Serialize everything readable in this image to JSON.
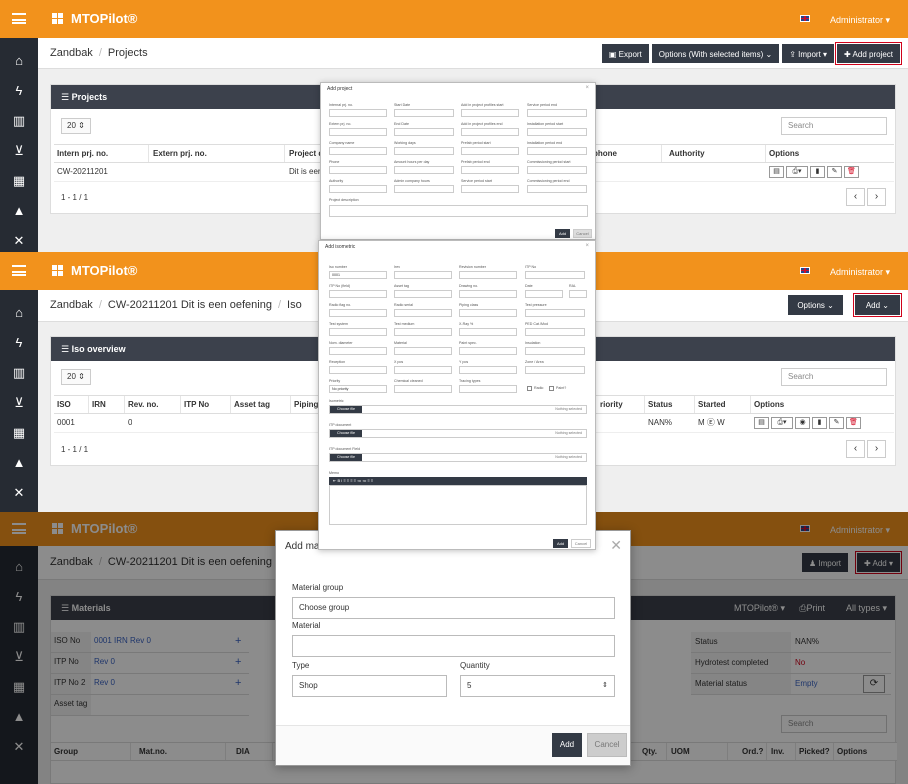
{
  "app": {
    "brand": "MTOPilot®",
    "user": "Administrator"
  },
  "nav_icons": [
    "home-icon",
    "bolt-icon",
    "books-icon",
    "cart-icon",
    "barcode-icon",
    "road-icon",
    "tools-icon"
  ],
  "panel1": {
    "crumbs": [
      "Zandbak",
      "Projects"
    ],
    "buttons": {
      "export": "Export",
      "options": "Options (With selected items) ⌄",
      "import": "Import ▾",
      "add": "✚ Add project"
    },
    "card_title": "Projects",
    "page_size": "20",
    "search_placeholder": "Search",
    "columns": [
      "Intern prj. no.",
      "Extern prj. no.",
      "Project d",
      "",
      "phone",
      "Authority",
      "Options"
    ],
    "row": [
      "CW-20211201",
      "",
      "Dit is een"
    ],
    "pager_info": "1 - 1 / 1",
    "modal": {
      "title": "Add project",
      "labels": [
        "Internal prj. no.",
        "Start Date",
        "Add in project profiles start",
        "Service period end",
        "Extern prj. no.",
        "End Date",
        "Add in project profiles end",
        "Installation period start",
        "Company name",
        "Working days",
        "Prefab period start",
        "Installation period end",
        "Phone",
        "Amount hours per day",
        "Prefab period end",
        "Commissioning period start",
        "Authority",
        "Admin company hours",
        "Service period start",
        "Commissioning period end"
      ],
      "description": "Project description",
      "add": "Add",
      "cancel": "Cancel"
    }
  },
  "panel2": {
    "crumbs": [
      "Zandbak",
      "CW-20211201 Dit is een oefening",
      "Iso"
    ],
    "buttons": {
      "options": "Options ⌄",
      "add": "Add ⌄"
    },
    "card_title": "Iso overview",
    "page_size": "20",
    "search_placeholder": "Search",
    "columns": [
      "ISO",
      "IRN",
      "Rev. no.",
      "ITP No",
      "Asset tag",
      "Piping",
      "riority",
      "Status",
      "Started",
      "Options"
    ],
    "row": {
      "iso": "0001",
      "rev": "0",
      "status": "NAN%",
      "started": "M Ⓔ W"
    },
    "pager_info": "1 - 1 / 1",
    "modal": {
      "title": "Add isometric",
      "labels": [
        "Iso number",
        "Irev",
        "Revision number",
        "ITP No",
        "ITP No (field)",
        "Asset tag",
        "Drawing no.",
        "Date",
        "RAL",
        "Radio flag no.",
        "Radio serial",
        "Piping class",
        "Test pressure",
        "Test system",
        "Test medium",
        "X-Ray %",
        "PED Cat./Mod",
        "Nom. diameter",
        "Material",
        "Paint spec.",
        "Insulation",
        "Reception",
        "X pos",
        "Y pos",
        "Zone / Area",
        "Priority",
        "Chemical cleaned",
        "Tracing types"
      ],
      "iso_value": "0001",
      "priority_value": "No priority",
      "checks": [
        "Radio",
        "Paint?"
      ],
      "files": [
        {
          "label": "Isometric",
          "button": "Choose file",
          "status": "Nothing selected"
        },
        {
          "label": "ITP document",
          "button": "Choose file",
          "status": "Nothing selected"
        },
        {
          "label": "ITP document Field",
          "button": "Choose file",
          "status": "Nothing selected"
        }
      ],
      "memo": "Memo",
      "add": "Add",
      "cancel": "Cancel"
    }
  },
  "panel3": {
    "crumbs": [
      "Zandbak",
      "CW-20211201 Dit is een oefening"
    ],
    "buttons": {
      "import": "Import",
      "add": "✚ Add ▾"
    },
    "card_title": "Materials",
    "card_tools": {
      "pilot": "MTOPilot® ▾",
      "print": "Print",
      "types": "All types ▾"
    },
    "left_rows": [
      {
        "label": "ISO No",
        "value": "0001 IRN Rev 0"
      },
      {
        "label": "ITP No",
        "value": "Rev 0"
      },
      {
        "label": "ITP No 2",
        "value": "Rev 0"
      },
      {
        "label": "Asset tag",
        "value": ""
      }
    ],
    "right_rows": [
      {
        "label": "Status",
        "value": "NAN%"
      },
      {
        "label": "Hydrotest completed",
        "value": "No"
      },
      {
        "label": "Material status",
        "value": "Empty"
      }
    ],
    "search_placeholder": "Search",
    "columns": [
      "Group",
      "Mat.no.",
      "DIA",
      "Qty.",
      "UOM",
      "Ord.?",
      "Inv.",
      "Picked?",
      "Options"
    ],
    "dialog": {
      "title": "Add material",
      "group_label": "Material group",
      "group_value": "Choose group",
      "material_label": "Material",
      "type_label": "Type",
      "type_value": "Shop",
      "quantity_label": "Quantity",
      "quantity_value": "5",
      "add": "Add",
      "cancel": "Cancel"
    }
  },
  "colors": {
    "topbar": "#f2921c",
    "sidebar": "#262b33",
    "button": "#333a45",
    "highlight": "#d0021b",
    "link": "#3a63c4"
  }
}
